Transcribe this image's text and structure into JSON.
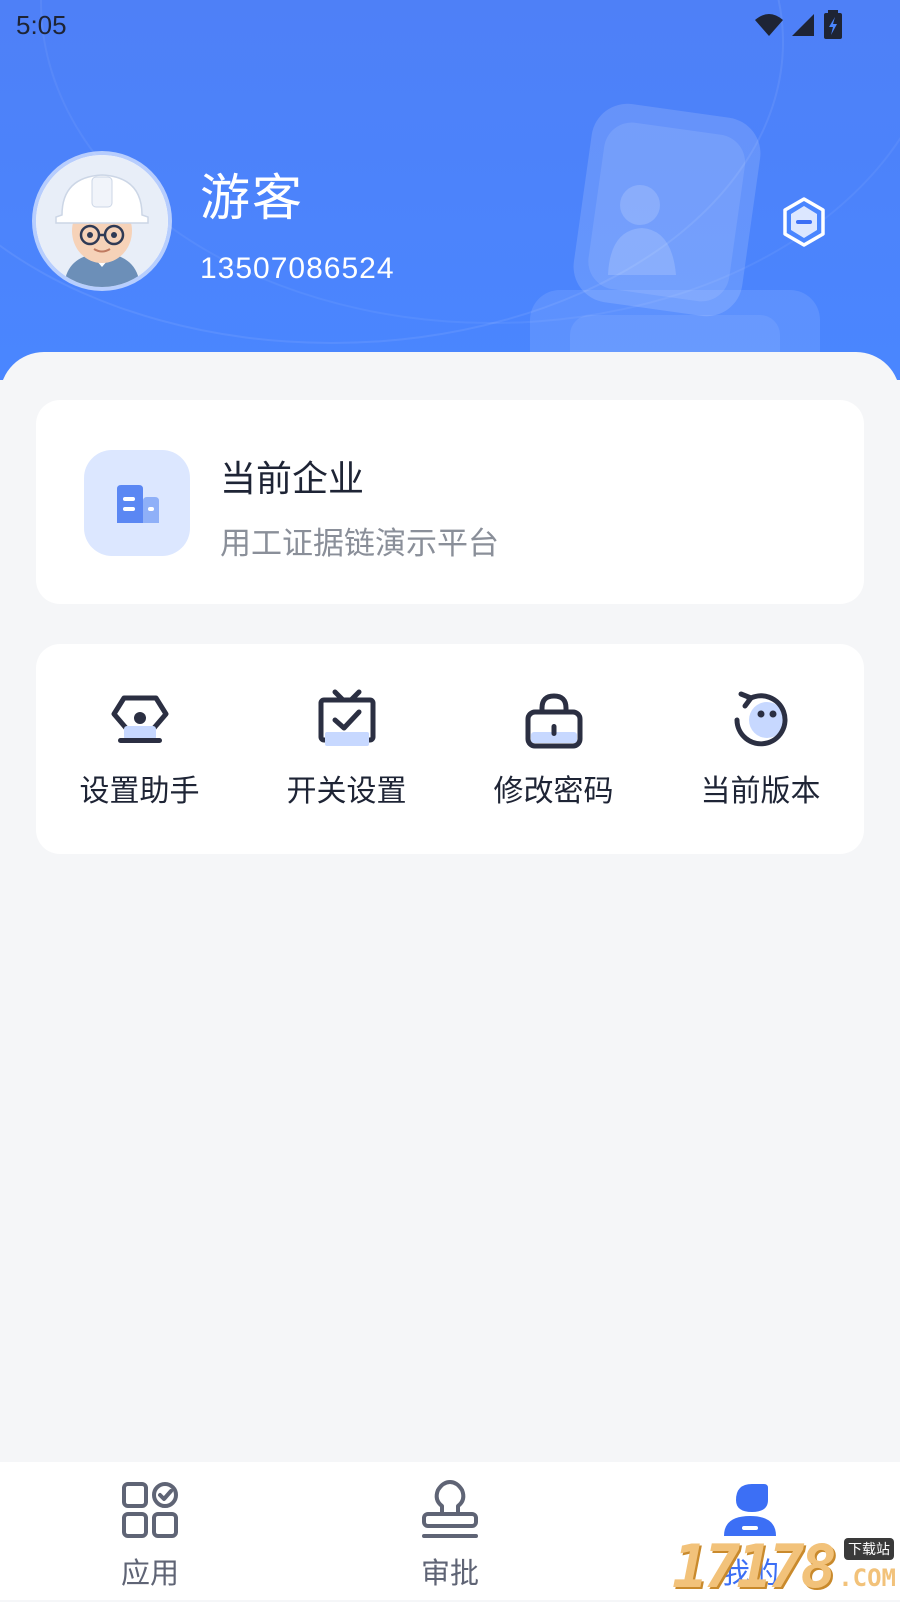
{
  "status_bar": {
    "time": "5:05",
    "icons": [
      "wifi-icon",
      "signal-icon",
      "battery-charging-icon"
    ]
  },
  "profile": {
    "name": "游客",
    "phone": "13507086524",
    "avatar": "avatar-engineer-hardhat",
    "action_icon": "hexagon-minus-icon"
  },
  "company_card": {
    "title": "当前企业",
    "subtitle": "用工证据链演示平台",
    "icon": "building-icon"
  },
  "menu": {
    "items": [
      {
        "label": "设置助手",
        "icon": "assistant-settings-icon"
      },
      {
        "label": "开关设置",
        "icon": "tv-check-icon"
      },
      {
        "label": "修改密码",
        "icon": "lock-icon"
      },
      {
        "label": "当前版本",
        "icon": "version-face-icon"
      }
    ]
  },
  "tabbar": {
    "tabs": [
      {
        "label": "应用",
        "icon": "apps-grid-icon",
        "active": false
      },
      {
        "label": "审批",
        "icon": "stamp-icon",
        "active": false
      },
      {
        "label": "我的",
        "icon": "user-profile-icon",
        "active": true
      }
    ]
  },
  "watermark": {
    "digits": "17178",
    "label_cn": "下载站",
    "label_com": ".COM"
  },
  "colors": {
    "header_blue": "#4A86FF",
    "accent_blue": "#3C6FF5",
    "light_blue": "#DCE7FF",
    "text_dark": "#1E2435",
    "text_gray": "#8A8F99",
    "background": "#F5F6F8"
  }
}
